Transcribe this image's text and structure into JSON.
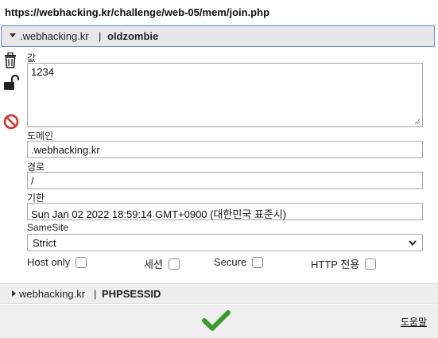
{
  "url": "https://webhacking.kr/challenge/web-05/mem/join.php",
  "cookie": {
    "domain": ".webhacking.kr",
    "separator": "|",
    "name": "oldzombie",
    "value_label": "값",
    "value": "1234",
    "domain_label": "도메인",
    "domain_value": ".webhacking.kr",
    "path_label": "경로",
    "path_value": "/",
    "expires_label": "기한",
    "expires_value": "Sun Jan 02 2022 18:59:14 GMT+0900 (대한민국 표준시)",
    "samesite_label": "SameSite",
    "samesite_value": "Strict",
    "hostonly_label": "Host only",
    "session_label": "세션",
    "secure_label": "Secure",
    "httponly_label": "HTTP 전용"
  },
  "cookie2": {
    "domain": "webhacking.kr",
    "separator": "|",
    "name": "PHPSESSID"
  },
  "footer": {
    "help_label": "도움말"
  },
  "icons": {
    "delete": "trash-icon",
    "protect": "unlock-icon",
    "block": "block-icon",
    "save": "checkmark-icon"
  },
  "colors": {
    "accent_border": "#6b8fd6",
    "block_red": "#d8302b",
    "save_green": "#3b9a2e"
  }
}
